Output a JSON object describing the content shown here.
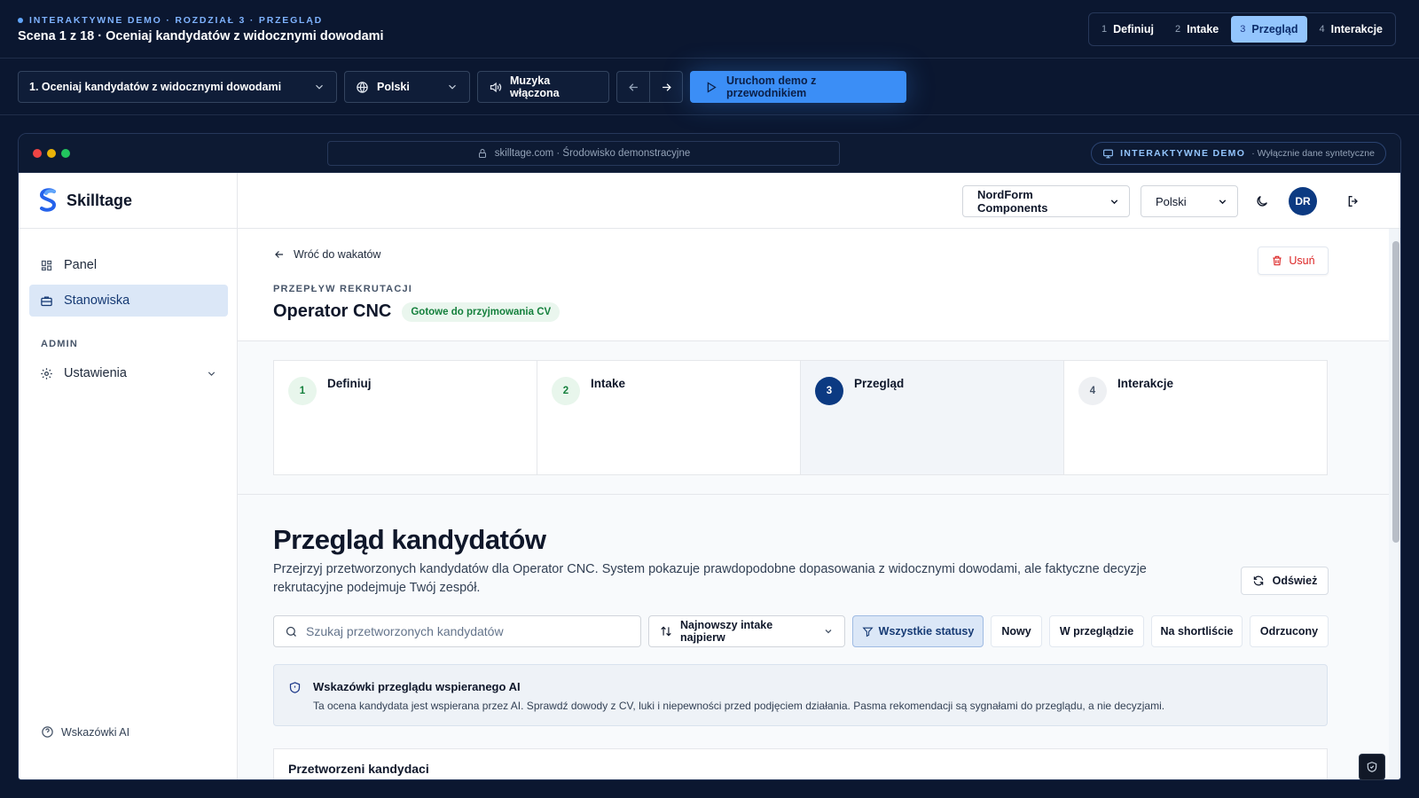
{
  "topbar": {
    "eyebrow": "INTERAKTYWNE DEMO · ROZDZIAŁ 3 · PRZEGLĄD",
    "scene_title": "Scena 1 z 18 · Oceniaj kandydatów z widocznymi dowodami",
    "steps": [
      {
        "num": "1",
        "label": "Definiuj",
        "active": false
      },
      {
        "num": "2",
        "label": "Intake",
        "active": false
      },
      {
        "num": "3",
        "label": "Przegląd",
        "active": true
      },
      {
        "num": "4",
        "label": "Interakcje",
        "active": false
      }
    ]
  },
  "controls": {
    "scene_select": "1. Oceniaj kandydatów z widocznymi dowodami",
    "language": "Polski",
    "music": "Muzyka włączona",
    "run_label": "Uruchom demo z przewodnikiem"
  },
  "browser": {
    "url": "skilltage.com · Środowisko demonstracyjne",
    "badge_label": "INTERAKTYWNE DEMO",
    "badge_sub": "· Wyłącznie dane syntetyczne"
  },
  "app": {
    "brand": "Skilltage",
    "nav": [
      {
        "label": "Panel",
        "active": false
      },
      {
        "label": "Stanowiska",
        "active": true
      }
    ],
    "admin_label": "ADMIN",
    "settings_label": "Ustawienia",
    "ai_hints": "Wskazówki AI",
    "company": "NordForm Components",
    "language": "Polski",
    "avatar": "DR",
    "colors": {
      "primary": "#0c3a82",
      "accent": "#3b8ef6",
      "success": "#15803d",
      "danger": "#dc2626"
    }
  },
  "job": {
    "back": "Wróć do wakatów",
    "delete": "Usuń",
    "flow_label": "PRZEPŁYW REKRUTACJI",
    "title": "Operator CNC",
    "status": "Gotowe do przyjmowania CV",
    "steps": [
      {
        "num": "1",
        "label": "Definiuj",
        "state": "done"
      },
      {
        "num": "2",
        "label": "Intake",
        "state": "done"
      },
      {
        "num": "3",
        "label": "Przegląd",
        "state": "current"
      },
      {
        "num": "4",
        "label": "Interakcje",
        "state": "todo"
      }
    ]
  },
  "review": {
    "title": "Przegląd kandydatów",
    "description": "Przejrzyj przetworzonych kandydatów dla Operator CNC. System pokazuje prawdopodobne dopasowania z widocznymi dowodami, ale faktyczne decyzje rekrutacyjne podejmuje Twój zespół.",
    "refresh": "Odśwież",
    "search_placeholder": "Szukaj przetworzonych kandydatów",
    "sort": "Najnowszy intake najpierw",
    "filters": [
      "Wszystkie statusy",
      "Nowy",
      "W przeglądzie",
      "Na shortliście",
      "Odrzucony"
    ],
    "hint_title": "Wskazówki przeglądu wspieranego AI",
    "hint_text": "Ta ocena kandydata jest wspierana przez AI. Sprawdź dowody z CV, luki i niepewności przed podjęciem działania. Pasma rekomendacji są sygnałami do przeglądu, a nie decyzjami.",
    "processed_title": "Przetworzeni kandydaci"
  }
}
